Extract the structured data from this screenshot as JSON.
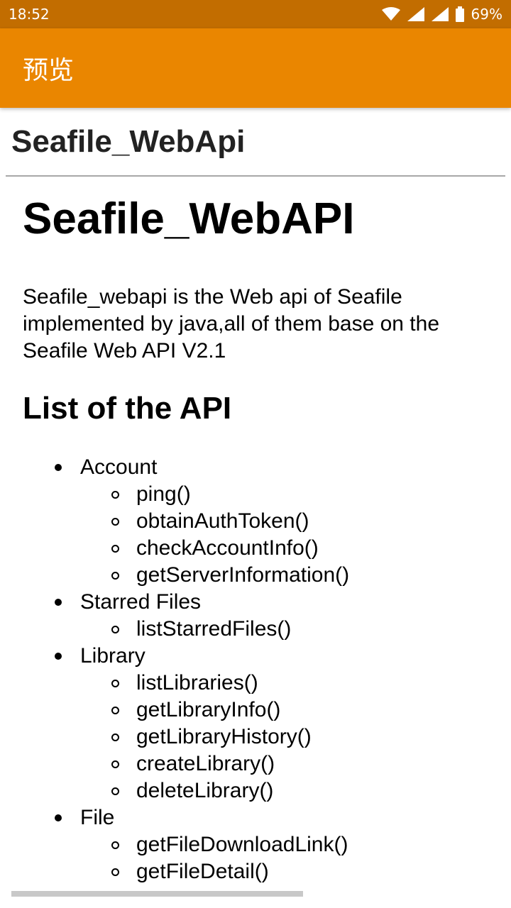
{
  "status_bar": {
    "time": "18:52",
    "battery_percent": "69%",
    "icons": [
      "wifi-icon",
      "signal-icon",
      "signal-icon",
      "battery-icon"
    ]
  },
  "app_bar": {
    "title": "预览"
  },
  "document": {
    "file_title": "Seafile_WebApi",
    "h1": "Seafile_WebAPI",
    "intro": "Seafile_webapi is the Web api of Seafile implemented by java,all of them base on the Seafile Web API V2.1",
    "h2": "List of the API",
    "api_groups": [
      {
        "name": "Account",
        "items": [
          "ping()",
          "obtainAuthToken()",
          "checkAccountInfo()",
          "getServerInformation()"
        ]
      },
      {
        "name": "Starred Files",
        "items": [
          "listStarredFiles()"
        ]
      },
      {
        "name": "Library",
        "items": [
          "listLibraries()",
          "getLibraryInfo()",
          "getLibraryHistory()",
          "createLibrary()",
          "deleteLibrary()"
        ]
      },
      {
        "name": "File",
        "items": [
          "getFileDownloadLink()",
          "getFileDetail()"
        ]
      }
    ]
  },
  "colors": {
    "status_bar": "#c26d00",
    "app_bar": "#ea8600"
  }
}
